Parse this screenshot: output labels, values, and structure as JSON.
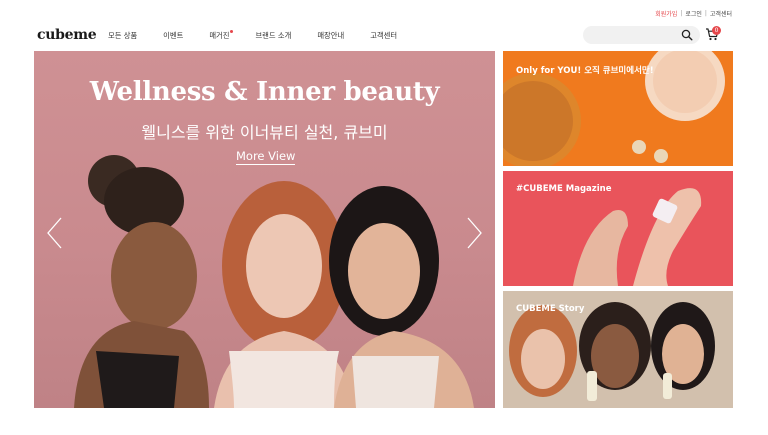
{
  "util_links": {
    "signup": "회원가입",
    "login": "로그인",
    "support": "고객센터",
    "separator": "|"
  },
  "header": {
    "logo": "cubeme",
    "nav": [
      {
        "label": "모든 상품",
        "dot": false
      },
      {
        "label": "이벤트",
        "dot": false
      },
      {
        "label": "매거진",
        "dot": true
      },
      {
        "label": "브랜드 소개",
        "dot": false
      },
      {
        "label": "매장안내",
        "dot": false
      },
      {
        "label": "고객센터",
        "dot": false
      }
    ],
    "search_placeholder": "",
    "cart_count": "0"
  },
  "hero": {
    "title": "Wellness & Inner beauty",
    "subtitle": "웰니스를 위한 이너뷰티 실천, 큐브미",
    "link": "More View",
    "background": "#cf9194"
  },
  "panels": [
    {
      "title": "Only for YOU! 오직 큐브미에서만!",
      "color": "#f07a1e"
    },
    {
      "title": "#CUBEME Magazine",
      "color": "#e9545b"
    },
    {
      "title": "CUBEME Story",
      "color": "#c9b6a4"
    }
  ],
  "colors": {
    "accent": "#e5474b"
  }
}
